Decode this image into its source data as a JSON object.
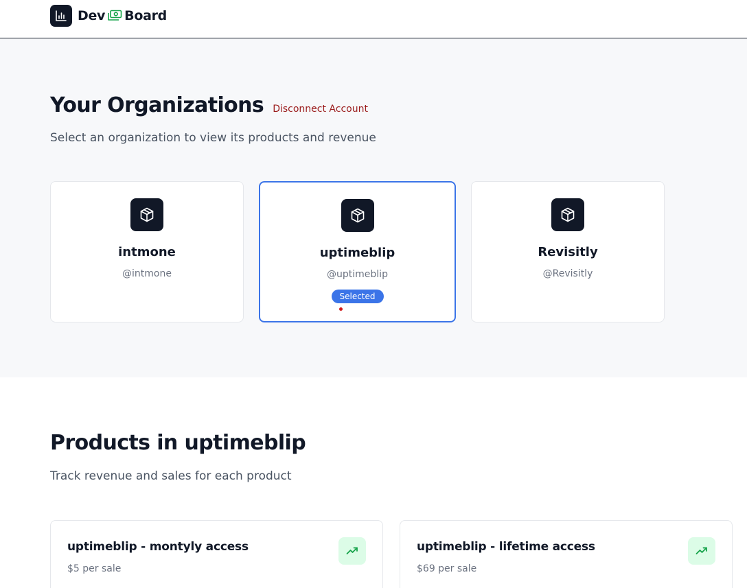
{
  "header": {
    "logo_prefix": "Dev",
    "logo_suffix": "Board",
    "icons": [
      "chart-icon",
      "money-icon"
    ]
  },
  "organizations": {
    "title": "Your Organizations",
    "disconnect_label": "Disconnect Account",
    "subtitle": "Select an organization to view its products and revenue",
    "items": [
      {
        "name": "intmone",
        "handle": "@intmone",
        "icon": "box-icon",
        "selected": false
      },
      {
        "name": "uptimeblip",
        "handle": "@uptimeblip",
        "icon": "box-icon",
        "selected": true,
        "badge": "Selected"
      },
      {
        "name": "Revisitly",
        "handle": "@Revisitly",
        "icon": "box-icon",
        "selected": false
      }
    ]
  },
  "products": {
    "title": "Products in uptimeblip",
    "subtitle": "Track revenue and sales for each product",
    "items": [
      {
        "name": "uptimeblip - montyly access",
        "price": "$5 per sale",
        "icon": "trending-up-icon"
      },
      {
        "name": "uptimeblip - lifetime access",
        "price": "$69 per sale",
        "icon": "trending-up-icon"
      }
    ]
  },
  "colors": {
    "accent": "#3b74e8",
    "danger": "#9b1c1c",
    "dark": "#111827",
    "success_bg": "#dcfce7",
    "success_fg": "#16a34a"
  }
}
